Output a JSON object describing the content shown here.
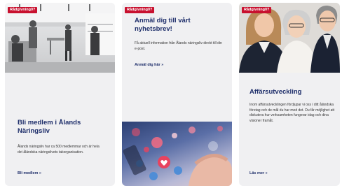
{
  "cards": [
    {
      "badge": "Rådgivning0?",
      "title": "Bli medlem i Ålands Näringsliv",
      "description": "Ålands näringsliv har ca 500 medlemmar och är hela det åländska näringslivets takorganisation.",
      "link": "Bli medlem »"
    },
    {
      "badge": "Rådgivning0?",
      "title": "Anmäl dig till vårt nyhetsbrev!",
      "description": "Få aktuell information från Ålands näringsliv direkt till din e-post.",
      "link": "Anmäl dig här »"
    },
    {
      "badge": "Rådgivning0?",
      "title": "Affärsutveckling",
      "description": "Inom affärsutvecklingen fördjupar vi oss i ditt åländska företag och de mål du har med det. Du får möjlighet att diskutera hur verksamheten fungerar idag och dina visioner framåt.",
      "link": "Läs mer »"
    }
  ],
  "colors": {
    "badge": "#c8102e",
    "title": "#1f2f6b",
    "card_bg": "#f0f0f2"
  }
}
